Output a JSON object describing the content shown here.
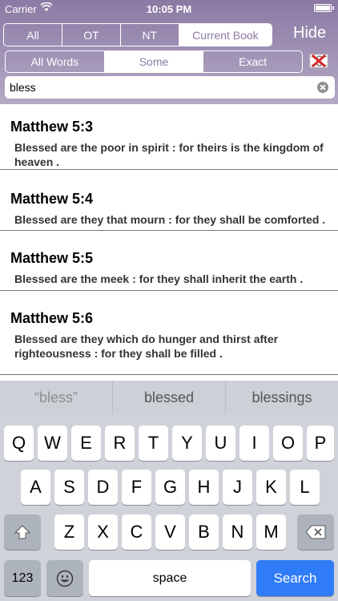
{
  "status_bar": {
    "carrier": "Carrier",
    "time": "10:05 PM"
  },
  "scope_tabs": [
    {
      "label": "All",
      "active": false
    },
    {
      "label": "OT",
      "active": false
    },
    {
      "label": "NT",
      "active": false
    },
    {
      "label": "Current Book",
      "active": true
    }
  ],
  "hide_label": "Hide",
  "match_modes": [
    {
      "label": "All Words",
      "active": false
    },
    {
      "label": "Some",
      "active": true
    },
    {
      "label": "Exact",
      "active": false
    }
  ],
  "search": {
    "value": "bless"
  },
  "results": [
    {
      "ref": "Matthew 5:3",
      "text": "Blessed are the poor in spirit : for theirs is the kingdom of heaven ."
    },
    {
      "ref": "Matthew 5:4",
      "text": "Blessed are they that mourn : for they shall be comforted ."
    },
    {
      "ref": "Matthew 5:5",
      "text": "Blessed are the meek : for they shall inherit the earth ."
    },
    {
      "ref": "Matthew 5:6",
      "text": "Blessed are they which do hunger and thirst after righteousness : for they shall be filled ."
    }
  ],
  "suggestions": [
    "“bless”",
    "blessed",
    "blessings"
  ],
  "keyboard": {
    "row1": [
      "Q",
      "W",
      "E",
      "R",
      "T",
      "Y",
      "U",
      "I",
      "O",
      "P"
    ],
    "row2": [
      "A",
      "S",
      "D",
      "F",
      "G",
      "H",
      "J",
      "K",
      "L"
    ],
    "row3": [
      "Z",
      "X",
      "C",
      "V",
      "B",
      "N",
      "M"
    ],
    "numbers_key": "123",
    "space_key": "space",
    "search_key": "Search"
  },
  "colors": {
    "header_top": "#8b7aa4",
    "header_bottom": "#b4aac4",
    "search_key": "#2f7cf6"
  }
}
